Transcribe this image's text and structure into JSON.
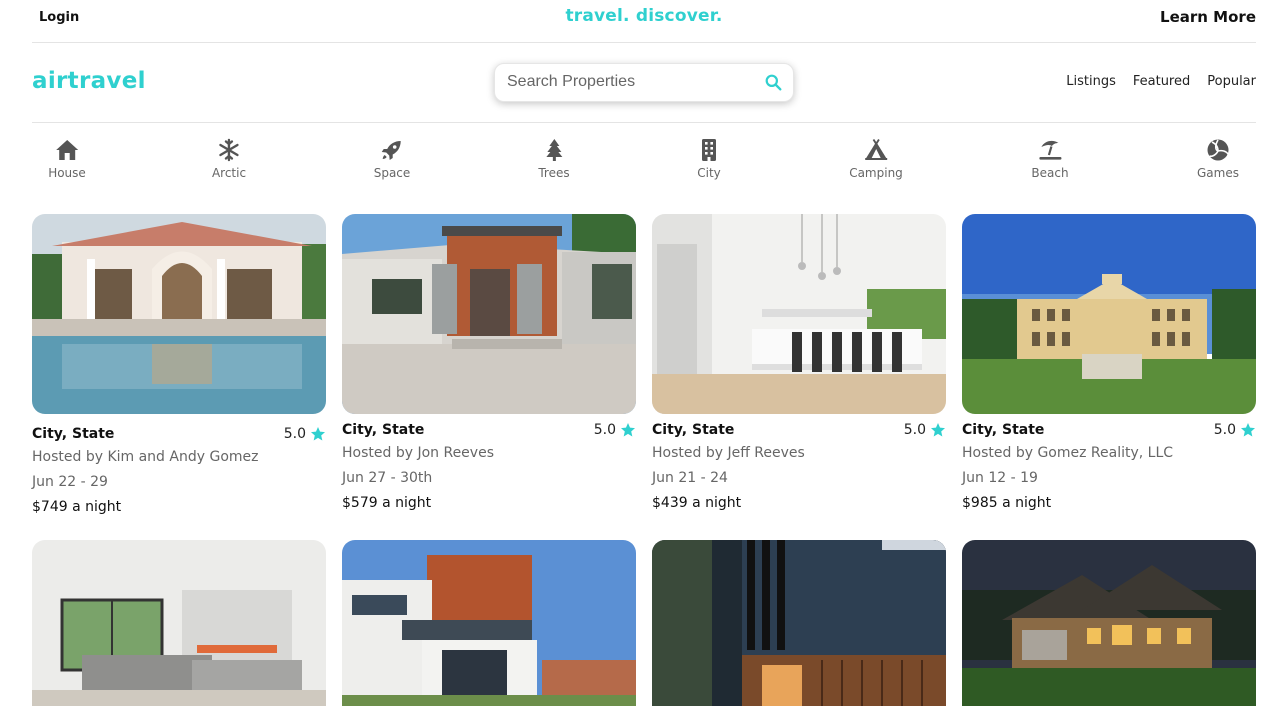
{
  "topbar": {
    "login": "Login",
    "tagline": "travel. discover.",
    "learn_more": "Learn More"
  },
  "header": {
    "logo": "airtravel",
    "search_placeholder": "Search Properties",
    "nav": [
      "Listings",
      "Featured",
      "Popular"
    ]
  },
  "categories": [
    {
      "label": "House",
      "icon": "house-icon"
    },
    {
      "label": "Arctic",
      "icon": "snowflake-icon"
    },
    {
      "label": "Space",
      "icon": "rocket-icon"
    },
    {
      "label": "Trees",
      "icon": "tree-icon"
    },
    {
      "label": "City",
      "icon": "building-icon"
    },
    {
      "label": "Camping",
      "icon": "tent-icon"
    },
    {
      "label": "Beach",
      "icon": "umbrella-beach-icon"
    },
    {
      "label": "Games",
      "icon": "volleyball-icon"
    }
  ],
  "listings": [
    {
      "location": "City, State",
      "rating": "5.0",
      "host": "Hosted by Kim and Andy Gomez",
      "dates": "Jun 22 - 29",
      "price": "$749 a night"
    },
    {
      "location": "City, State",
      "rating": "5.0",
      "host": "Hosted by Jon Reeves",
      "dates": "Jun 27 - 30th",
      "price": "$579 a night"
    },
    {
      "location": "City, State",
      "rating": "5.0",
      "host": "Hosted by Jeff Reeves",
      "dates": "Jun 21 - 24",
      "price": "$439 a night"
    },
    {
      "location": "City, State",
      "rating": "5.0",
      "host": "Hosted by Gomez Reality, LLC",
      "dates": "Jun 12 - 19",
      "price": "$985 a night"
    }
  ],
  "colors": {
    "accent": "#2fd0cf",
    "text": "#111111",
    "muted": "#666666"
  }
}
